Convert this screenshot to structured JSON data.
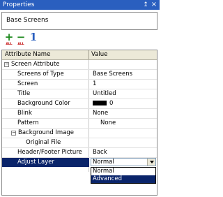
{
  "window": {
    "title": "Properties",
    "pin_glyph": "↥",
    "close_glyph": "×"
  },
  "object_name": "Base Screens",
  "toolbar": {
    "add_all": {
      "symbol": "+",
      "caption": "ALL"
    },
    "remove_all": {
      "symbol": "−",
      "caption": "ALL"
    },
    "sort": {
      "symbol": "1"
    }
  },
  "grid": {
    "headers": {
      "name": "Attribute Name",
      "value": "Value"
    },
    "rows": [
      {
        "name": "Screen Attribute",
        "toggle": "−",
        "value": ""
      },
      {
        "name": "Screens of Type",
        "value": "Base Screens"
      },
      {
        "name": "Screen",
        "value": "1"
      },
      {
        "name": "Title",
        "value": "Untitled"
      },
      {
        "name": "Background Color",
        "value": "0"
      },
      {
        "name": "Blink",
        "value": "None"
      },
      {
        "name": "Pattern",
        "value": "None"
      },
      {
        "name": "Background Image",
        "toggle": "−",
        "value": ""
      },
      {
        "name": "Original File",
        "value": ""
      },
      {
        "name": "Header/Footer Picture",
        "value": "Back"
      },
      {
        "name": "Adjust Layer",
        "value": "Normal"
      }
    ]
  },
  "dropdown": {
    "options": [
      "Normal",
      "Advanced"
    ],
    "highlighted": "Advanced"
  },
  "colors": {
    "title_bar": "#2a5fbf",
    "selection": "#0a246a",
    "header_bg": "#ece9d8"
  }
}
